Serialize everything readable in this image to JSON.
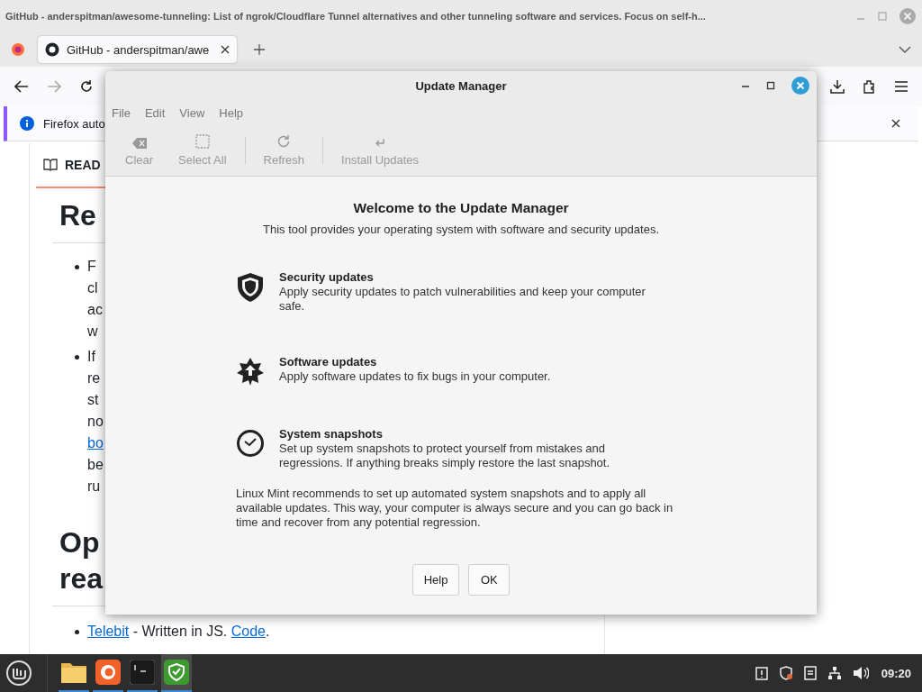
{
  "browser": {
    "title": "GitHub - anderspitman/awesome-tunneling: List of ngrok/Cloudflare Tunnel alternatives and other tunneling software and services. Focus on self-h...",
    "tabs": [
      {
        "label": "GitHub - anderspitman/awe",
        "selected": true
      }
    ],
    "notification": "Firefox auto",
    "readme_tab": "READ",
    "heading_1": "Re",
    "bullets": [
      {
        "lines": [
          {
            "text": "F",
            "link": false
          },
          {
            "text": "cl",
            "link": false
          },
          {
            "text": "ac",
            "link": false
          },
          {
            "text": "w",
            "link": false
          }
        ]
      },
      {
        "lines": [
          {
            "text": "If",
            "link": false
          },
          {
            "text": "re",
            "link": false
          },
          {
            "text": "st",
            "link": false
          },
          {
            "text": "no",
            "link": false
          },
          {
            "text": "bo",
            "link": true
          },
          {
            "text": "be",
            "link": false
          },
          {
            "text": "ru",
            "link": false
          }
        ]
      }
    ],
    "heading_2": [
      "Op",
      "rea"
    ],
    "last_bullet": {
      "link_1": "Telebit",
      "middle": " - Written in JS. ",
      "link_2": "Code",
      "end": "."
    }
  },
  "dialog": {
    "title": "Update Manager",
    "menu": [
      "File",
      "Edit",
      "View",
      "Help"
    ],
    "toolbar": [
      {
        "label": "Clear",
        "kind": "clear",
        "disabled": true
      },
      {
        "label": "Select All",
        "kind": "select",
        "disabled": true
      },
      {
        "label": "Refresh",
        "kind": "refresh",
        "disabled": true
      },
      {
        "label": "Install Updates",
        "kind": "install",
        "disabled": true
      }
    ],
    "heading": "Welcome to the Update Manager",
    "subtitle": "This tool provides your operating system with software and security updates.",
    "features": [
      {
        "kind": "shield",
        "title": "Security updates",
        "text": "Apply security updates to patch vulnerabilities and keep your computer safe."
      },
      {
        "kind": "star",
        "title": "Software updates",
        "text": "Apply software updates to fix bugs in your computer."
      },
      {
        "kind": "clock",
        "title": "System snapshots",
        "text": "Set up system snapshots to protect yourself from mistakes and regressions. If anything breaks simply restore the last snapshot."
      }
    ],
    "note": "Linux Mint recommends to set up automated system snapshots and to apply all available updates. This way, your computer is always secure and you can go back in time and recover from any potential regression.",
    "buttons": [
      "Help",
      "OK"
    ]
  },
  "taskbar": {
    "apps": [
      {
        "kind": "folder",
        "selected": false
      },
      {
        "kind": "firefox",
        "selected": false
      },
      {
        "kind": "terminal",
        "selected": false
      },
      {
        "kind": "shield",
        "selected": true
      }
    ],
    "clock": "09:20"
  }
}
